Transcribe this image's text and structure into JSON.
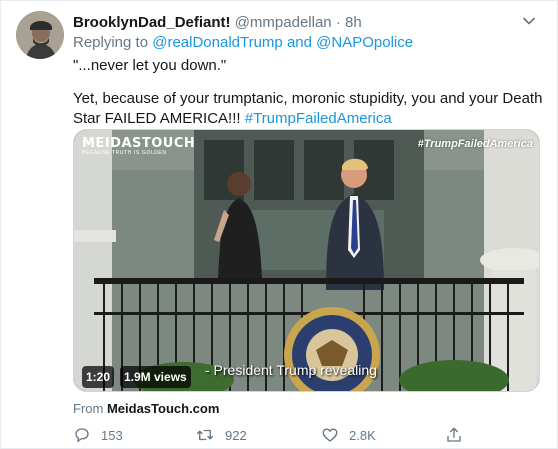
{
  "tweet": {
    "author_name": "BrooklynDad_Defiant!",
    "author_handle": "@mmpadellan",
    "separator": "·",
    "time": "8h",
    "reply_prefix": "Replying to",
    "reply_user_1": "@realDonaldTrump",
    "reply_and": "and",
    "reply_user_2": "@NAPOpolice",
    "text_line1": "\"...never let you down.\"",
    "text_line2": "Yet, because of your trumptanic, moronic stupidity, you and your Death Star FAILED AMERICA!!!",
    "text_hashtag": "#TrumpFailedAmerica"
  },
  "media": {
    "brand_title": "MEIDASTOUCH",
    "brand_subtitle": "BECAUSE TRUTH IS GOLDEN",
    "hashtag": "#TrumpFailedAmerica",
    "caption": "- President Trump revealing",
    "duration": "1:20",
    "views": "1.9M views",
    "seal_text": "PRESIDENT OF THE UNITED STATES"
  },
  "source": {
    "prefix": "From",
    "name": "MeidasTouch.com"
  },
  "actions": {
    "replies": "153",
    "retweets": "922",
    "likes": "2.8K"
  },
  "colors": {
    "link": "#1b95e0",
    "muted": "#657786",
    "text": "#14171a"
  },
  "icons": [
    "caret-down-icon",
    "reply-icon",
    "retweet-icon",
    "like-icon",
    "share-icon"
  ]
}
